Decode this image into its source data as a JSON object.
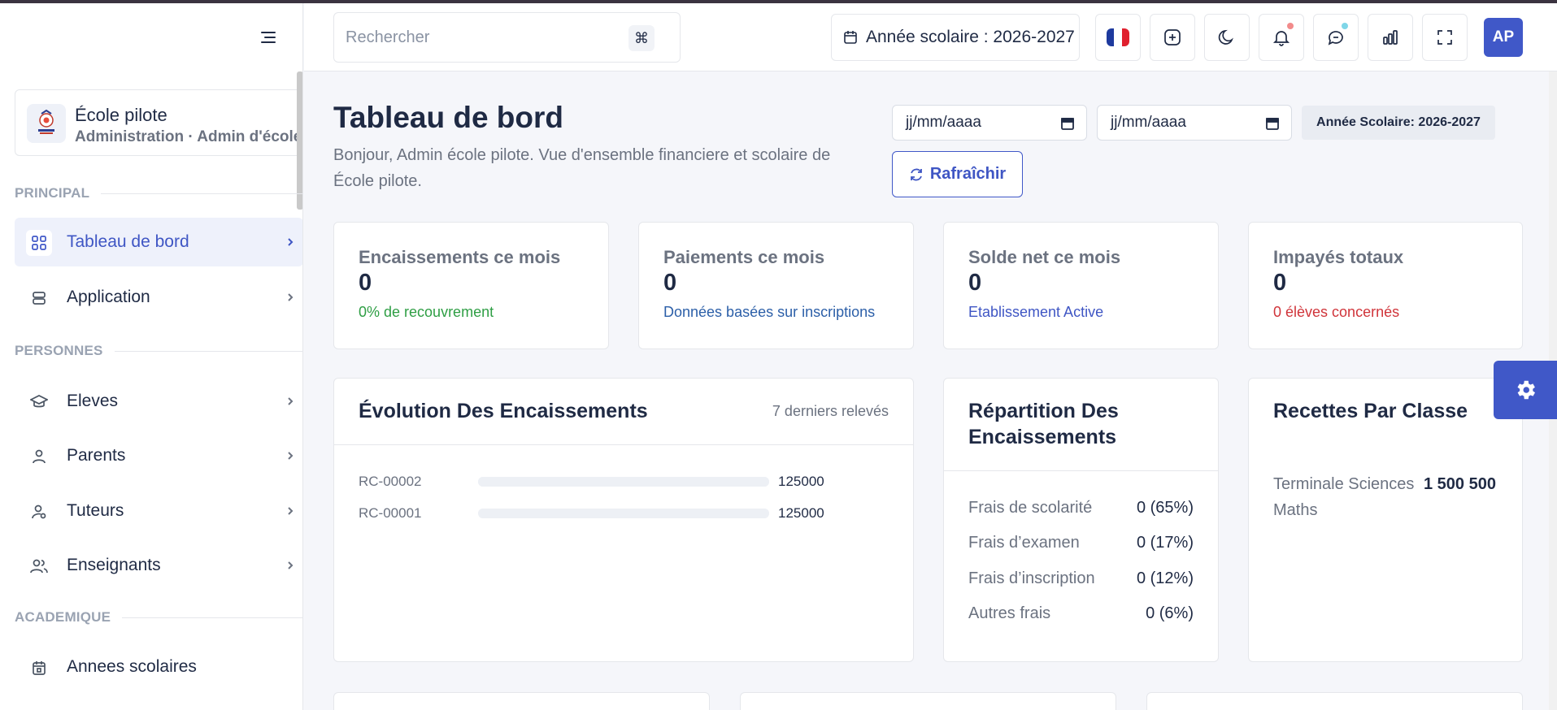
{
  "sidebar": {
    "school": {
      "name": "École pilote",
      "role": "Administration · Admin d'école"
    },
    "sections": {
      "principal": "PRINCIPAL",
      "personnes": "PERSONNES",
      "academique": "ACADEMIQUE"
    },
    "items": [
      {
        "label": "Tableau de bord",
        "icon": "dashboard-icon",
        "active": true
      },
      {
        "label": "Application",
        "icon": "server-icon"
      },
      {
        "label": "Eleves",
        "icon": "graduation-cap-icon"
      },
      {
        "label": "Parents",
        "icon": "user-icon"
      },
      {
        "label": "Tuteurs",
        "icon": "user-search-icon"
      },
      {
        "label": "Enseignants",
        "icon": "users-icon"
      },
      {
        "label": "Annees scolaires",
        "icon": "calendar-icon"
      }
    ]
  },
  "topbar": {
    "search_placeholder": "Rechercher",
    "shortcut": "⌘",
    "year_label": "Année scolaire : 2026-2027",
    "avatar": "AP",
    "notification_dot_color": "#f28b8b",
    "message_dot_color": "#7fd6e8"
  },
  "header": {
    "title": "Tableau de bord",
    "subtitle": "Bonjour, Admin école pilote. Vue d'ensemble financiere et scolaire de École pilote.",
    "date_placeholder": "jj/mm/aaaa",
    "year_chip": "Année Scolaire: 2026-2027",
    "refresh_label": "Rafraîchir"
  },
  "stats": [
    {
      "label": "Encaissements ce mois",
      "value": "0",
      "note": "0% de recouvrement",
      "note_color": "#2e9e44"
    },
    {
      "label": "Paiements ce mois",
      "value": "0",
      "note": "Données basées sur inscriptions",
      "note_color": "#2c5fa8"
    },
    {
      "label": "Solde net ce mois",
      "value": "0",
      "note": "Etablissement Active",
      "note_color": "#3f56c4"
    },
    {
      "label": "Impayés totaux",
      "value": "0",
      "note": "0 élèves concernés",
      "note_color": "#d0343a"
    }
  ],
  "evolution": {
    "title": "Évolution Des Encaissements",
    "meta": "7 derniers relevés",
    "rows": [
      {
        "code": "RC-00002",
        "amount": "125000",
        "fill": 1.0
      },
      {
        "code": "RC-00001",
        "amount": "125000",
        "fill": 1.0
      }
    ]
  },
  "repartition": {
    "title": "Répartition Des Encaissements",
    "rows": [
      {
        "label": "Frais de scolarité",
        "value": "0 (65%)"
      },
      {
        "label": "Frais d’examen",
        "value": "0 (17%)"
      },
      {
        "label": "Frais d’inscription",
        "value": "0 (12%)"
      },
      {
        "label": "Autres frais",
        "value": "0 (6%)"
      }
    ]
  },
  "recettes": {
    "title": "Recettes Par Classe",
    "classe": "Terminale Sciences Maths",
    "amount": "1 500 500"
  },
  "colors": {
    "accent": "#4058c8",
    "text": "#1f2a44",
    "muted": "#6b7280"
  }
}
